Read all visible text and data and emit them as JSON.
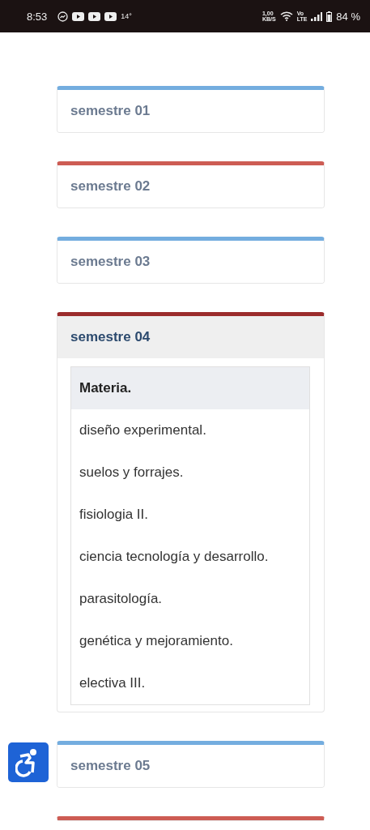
{
  "status_bar": {
    "time": "8:53",
    "temperature": "14°",
    "speed_value": "1,00",
    "speed_unit": "KB/S",
    "network_top": "Vo",
    "network_bottom": "LTE",
    "battery": "84 %"
  },
  "semesters": [
    {
      "title": "semestre 01",
      "color": "#74addf",
      "expanded": false
    },
    {
      "title": "semestre 02",
      "color": "#cd5c54",
      "expanded": false
    },
    {
      "title": "semestre 03",
      "color": "#74addf",
      "expanded": false
    },
    {
      "title": "semestre 04",
      "color": "#9b2c2c",
      "expanded": true,
      "table": {
        "header": "Materia.",
        "rows": [
          "diseño experimental.",
          "suelos y forrajes.",
          "fisiologia II.",
          "ciencia tecnología y desarrollo.",
          "parasitología.",
          "genética y mejoramiento.",
          "electiva III."
        ]
      }
    },
    {
      "title": "semestre 05",
      "color": "#74addf",
      "expanded": false
    },
    {
      "color": "#cd5c54"
    }
  ]
}
